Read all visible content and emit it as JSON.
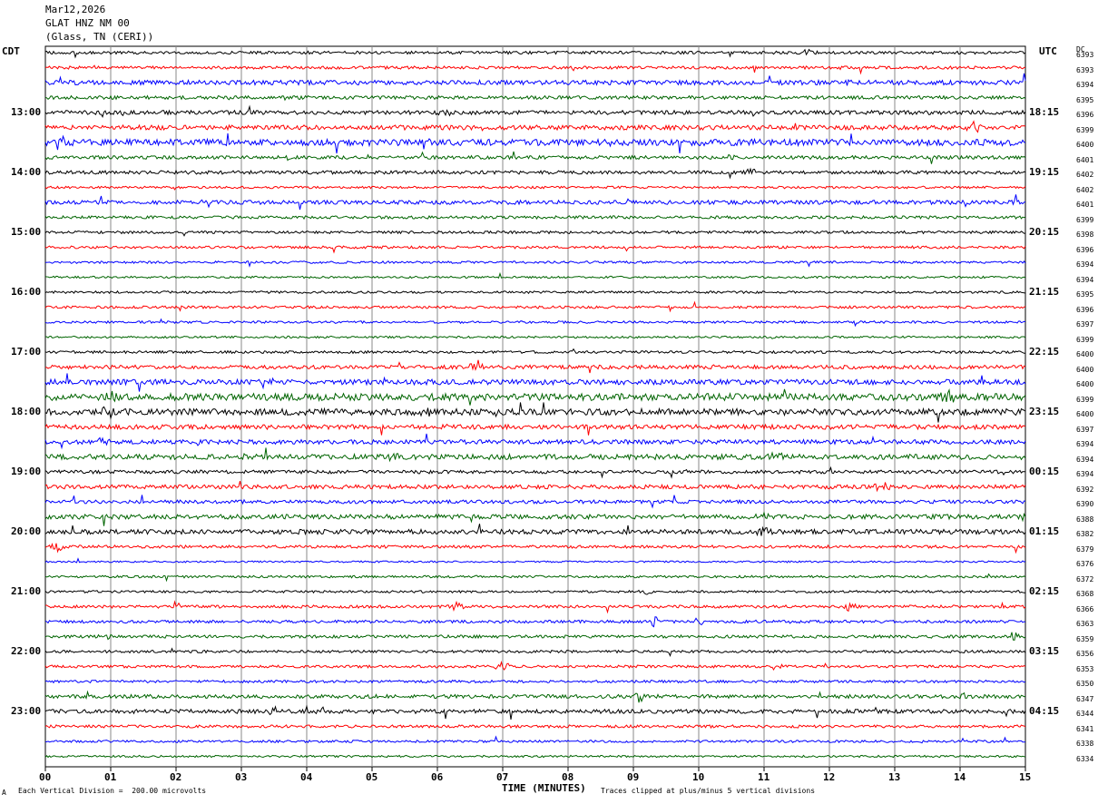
{
  "header": {
    "date": "Mar12,2026",
    "station": "GLAT HNZ NM 00",
    "location": "(Glass, TN (CERI))"
  },
  "left_zone": "CDT",
  "right_zone": "UTC",
  "dc_header": "DC",
  "chart_data": {
    "type": "line",
    "title": "",
    "xlabel": "TIME (MINUTES)",
    "xlim": [
      0,
      15
    ],
    "x_ticks": [
      "00",
      "01",
      "02",
      "03",
      "04",
      "05",
      "06",
      "07",
      "08",
      "09",
      "10",
      "11",
      "12",
      "13",
      "14",
      "15"
    ],
    "trace_count": 48,
    "trace_colors": [
      "#000000",
      "#ff0000",
      "#0000ff",
      "#006400"
    ],
    "left_hour_labels": [
      "13:00",
      "14:00",
      "15:00",
      "16:00",
      "17:00",
      "18:00",
      "19:00",
      "20:00",
      "21:00",
      "22:00",
      "23:00"
    ],
    "right_hour_labels": [
      "18:15",
      "19:15",
      "20:15",
      "21:15",
      "22:15",
      "23:15",
      "00:15",
      "01:15",
      "02:15",
      "03:15",
      "04:15"
    ],
    "dc_offsets": [
      "6393",
      "6393",
      "6394",
      "6395",
      "6396",
      "6399",
      "6400",
      "6401",
      "6402",
      "6402",
      "6401",
      "6399",
      "6398",
      "6396",
      "6394",
      "6394",
      "6395",
      "6396",
      "6397",
      "6399",
      "6400",
      "6400",
      "6400",
      "6399",
      "6400",
      "6397",
      "6394",
      "6394",
      "6394",
      "6392",
      "6390",
      "6388",
      "6382",
      "6379",
      "6376",
      "6372",
      "6368",
      "6366",
      "6363",
      "6359",
      "6356",
      "6353",
      "6350",
      "6347",
      "6344",
      "6341",
      "6338",
      "6334"
    ]
  },
  "footer": {
    "scale_note": "Each Vertical Division =  200.00 microvolts",
    "clip_note": "Traces clipped at plus/minus 5 vertical divisions",
    "marker": "A"
  }
}
